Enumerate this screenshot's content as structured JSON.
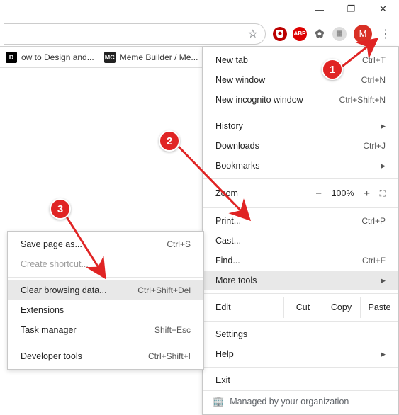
{
  "window": {
    "min": "—",
    "max": "❐",
    "close": "✕"
  },
  "omnibox": {
    "star": "☆"
  },
  "extensions": {
    "ublock": "◯",
    "abp": "ABP",
    "gen1": "✿",
    "gen2": "▦"
  },
  "profile": {
    "initial": "M"
  },
  "kebab": "⋮",
  "bookmarks": [
    {
      "icon": "D",
      "text": "ow to Design and..."
    },
    {
      "icon": "MC",
      "text": "Meme Builder / Me..."
    }
  ],
  "menu": {
    "newtab": {
      "label": "New tab",
      "accel": "Ctrl+T"
    },
    "newwindow": {
      "label": "New window",
      "accel": "Ctrl+N"
    },
    "incognito": {
      "label": "New incognito window",
      "accel": "Ctrl+Shift+N"
    },
    "history": {
      "label": "History"
    },
    "downloads": {
      "label": "Downloads",
      "accel": "Ctrl+J"
    },
    "bookmarks": {
      "label": "Bookmarks"
    },
    "zoom": {
      "label": "Zoom",
      "minus": "−",
      "pct": "100%",
      "plus": "+",
      "full": "⛶"
    },
    "print": {
      "label": "Print...",
      "accel": "Ctrl+P"
    },
    "cast": {
      "label": "Cast..."
    },
    "find": {
      "label": "Find...",
      "accel": "Ctrl+F"
    },
    "moretools": {
      "label": "More tools"
    },
    "edit": {
      "label": "Edit",
      "cut": "Cut",
      "copy": "Copy",
      "paste": "Paste"
    },
    "settings": {
      "label": "Settings"
    },
    "help": {
      "label": "Help"
    },
    "exit": {
      "label": "Exit"
    },
    "managed": {
      "label": "Managed by your organization"
    }
  },
  "submenu": {
    "savepage": {
      "label": "Save page as...",
      "accel": "Ctrl+S"
    },
    "shortcut": {
      "label": "Create shortcut..."
    },
    "clear": {
      "label": "Clear browsing data...",
      "accel": "Ctrl+Shift+Del"
    },
    "extensions": {
      "label": "Extensions"
    },
    "taskmgr": {
      "label": "Task manager",
      "accel": "Shift+Esc"
    },
    "devtools": {
      "label": "Developer tools",
      "accel": "Ctrl+Shift+I"
    }
  },
  "anno": {
    "one": "1",
    "two": "2",
    "three": "3"
  }
}
